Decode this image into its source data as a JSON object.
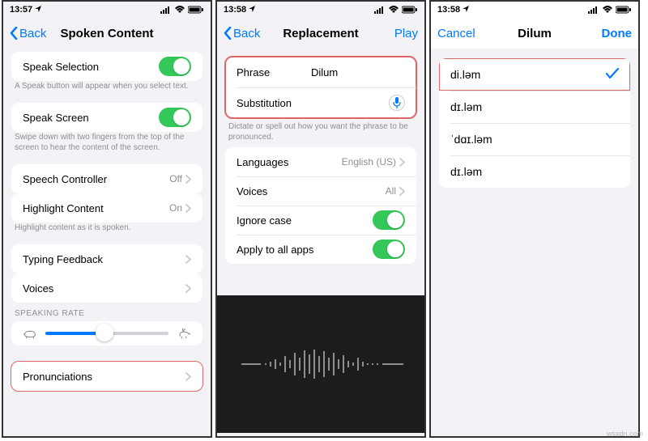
{
  "status": {
    "time1": "13:57",
    "time2": "13:58",
    "time3": "13:58"
  },
  "screen1": {
    "back": "Back",
    "title": "Spoken Content",
    "speak_selection": "Speak Selection",
    "speak_selection_hint": "A Speak button will appear when you select text.",
    "speak_screen": "Speak Screen",
    "speak_screen_hint": "Swipe down with two fingers from the top of the screen to hear the content of the screen.",
    "speech_controller": "Speech Controller",
    "speech_controller_val": "Off",
    "highlight_content": "Highlight Content",
    "highlight_content_val": "On",
    "highlight_content_hint": "Highlight content as it is spoken.",
    "typing_feedback": "Typing Feedback",
    "voices": "Voices",
    "speaking_rate_header": "SPEAKING RATE",
    "pronunciations": "Pronunciations"
  },
  "screen2": {
    "back": "Back",
    "title": "Replacement",
    "play": "Play",
    "phrase_label": "Phrase",
    "phrase_value": "Dilum",
    "substitution_label": "Substitution",
    "hint": "Dictate or spell out how you want the phrase to be pronounced.",
    "languages_label": "Languages",
    "languages_val": "English (US)",
    "voices_label": "Voices",
    "voices_val": "All",
    "ignore_case": "Ignore case",
    "apply_all": "Apply to all apps"
  },
  "screen3": {
    "cancel": "Cancel",
    "title": "Dilum",
    "done": "Done",
    "options": [
      "di.ləm",
      "dɪ.ləm",
      "ˈdɑɪ.ləm",
      "dɪ.ləm"
    ],
    "selected_index": 0
  },
  "watermark": "wsxdn.com"
}
